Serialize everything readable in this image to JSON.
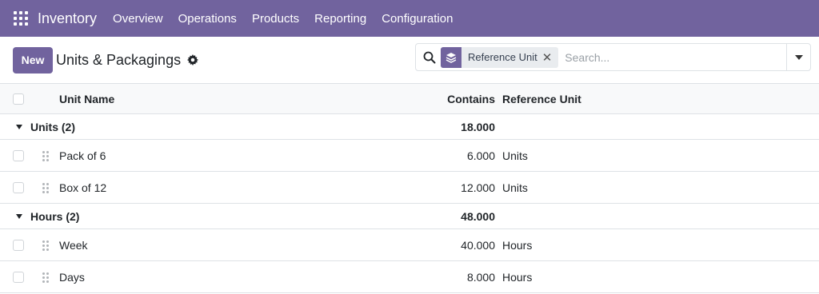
{
  "navbar": {
    "app_name": "Inventory",
    "menu": [
      "Overview",
      "Operations",
      "Products",
      "Reporting",
      "Configuration"
    ]
  },
  "control_panel": {
    "new_label": "New",
    "title": "Units & Packagings"
  },
  "search": {
    "facet_label": "Reference Unit",
    "placeholder": "Search..."
  },
  "table": {
    "headers": {
      "name": "Unit Name",
      "contains": "Contains",
      "reference": "Reference Unit"
    },
    "groups": [
      {
        "label": "Units (2)",
        "total": "18.000",
        "rows": [
          {
            "name": "Pack of 6",
            "contains": "6.000",
            "reference": "Units"
          },
          {
            "name": "Box of 12",
            "contains": "12.000",
            "reference": "Units"
          }
        ]
      },
      {
        "label": "Hours (2)",
        "total": "48.000",
        "rows": [
          {
            "name": "Week",
            "contains": "40.000",
            "reference": "Hours"
          },
          {
            "name": "Days",
            "contains": "8.000",
            "reference": "Hours"
          }
        ]
      }
    ]
  },
  "colors": {
    "brand": "#71639e",
    "border": "#dee2e6",
    "header_bg": "#f8f9fa"
  }
}
